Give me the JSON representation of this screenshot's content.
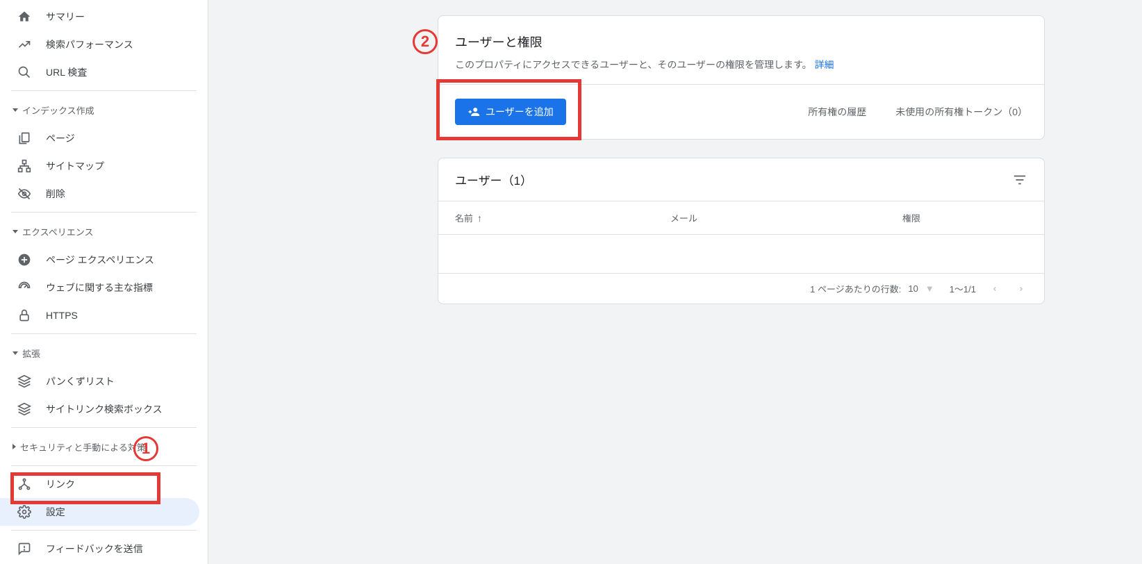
{
  "sidebar": {
    "items": [
      {
        "label": "サマリー"
      },
      {
        "label": "検索パフォーマンス"
      },
      {
        "label": "URL 検査"
      }
    ],
    "section_index_label": "インデックス作成",
    "index_items": [
      {
        "label": "ページ"
      },
      {
        "label": "サイトマップ"
      },
      {
        "label": "削除"
      }
    ],
    "section_experience_label": "エクスペリエンス",
    "experience_items": [
      {
        "label": "ページ エクスペリエンス"
      },
      {
        "label": "ウェブに関する主な指標"
      },
      {
        "label": "HTTPS"
      }
    ],
    "section_enhance_label": "拡張",
    "enhance_items": [
      {
        "label": "パンくずリスト"
      },
      {
        "label": "サイトリンク検索ボックス"
      }
    ],
    "section_security_label": "セキュリティと手動による対策",
    "links_label": "リンク",
    "settings_label": "設定",
    "feedback_label": "フィードバックを送信"
  },
  "main": {
    "perm_title": "ユーザーと権限",
    "perm_desc": "このプロパティにアクセスできるユーザーと、そのユーザーの権限を管理します。",
    "details_link": "詳細",
    "add_user_btn": "ユーザーを追加",
    "ownership_history": "所有権の履歴",
    "unused_tokens": "未使用の所有権トークン（0）",
    "users_title": "ユーザー（1）",
    "col_name": "名前",
    "col_email": "メール",
    "col_perm": "権限",
    "rows_per_page": "1 ページあたりの行数:",
    "rows_value": "10",
    "range": "1～1/1"
  },
  "annotations": {
    "one": "1",
    "two": "2"
  }
}
